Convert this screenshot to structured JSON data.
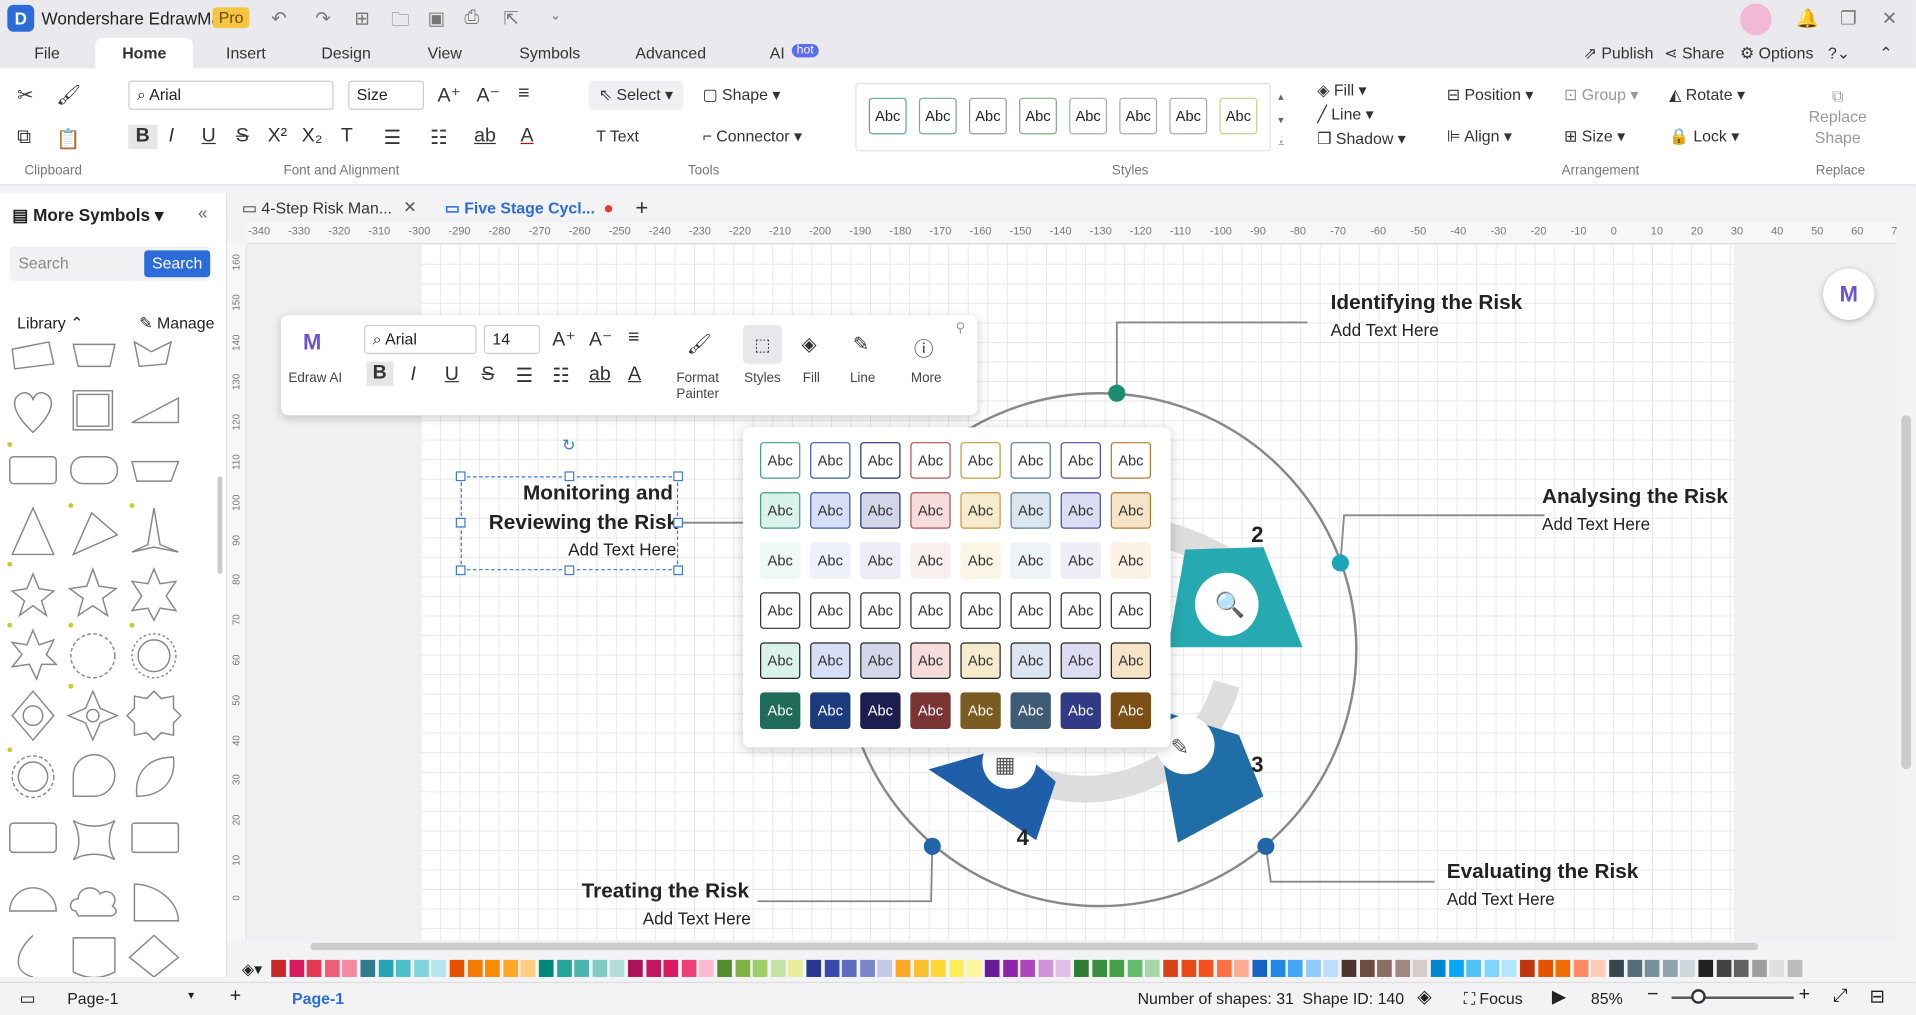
{
  "app": {
    "title": "Wondershare EdrawMax",
    "badge": "Pro"
  },
  "menu_tabs": [
    "File",
    "Home",
    "Insert",
    "Design",
    "View",
    "Symbols",
    "Advanced",
    "AI"
  ],
  "hot_badge": "hot",
  "top_right": {
    "publish": "Publish",
    "share": "Share",
    "options": "Options"
  },
  "ribbon": {
    "font": "Arial",
    "size": "Size",
    "select": "Select",
    "shape": "Shape",
    "text": "Text",
    "connector": "Connector",
    "style_samples": [
      "Abc",
      "Abc",
      "Abc",
      "Abc",
      "Abc",
      "Abc",
      "Abc",
      "Abc"
    ],
    "fill": "Fill",
    "line": "Line",
    "shadow": "Shadow",
    "position": "Position",
    "group": "Group",
    "rotate": "Rotate",
    "align": "Align",
    "lock": "Lock",
    "replace_shape": "Replace Shape",
    "groups": [
      "Clipboard",
      "Font and Alignment",
      "Tools",
      "Styles",
      "Arrangement",
      "Replace"
    ]
  },
  "sidebar": {
    "title": "More Symbols",
    "search_placeholder": "Search",
    "search_button": "Search",
    "library": "Library",
    "manage": "Manage"
  },
  "doc_tabs": [
    {
      "label": "4-Step Risk Man..."
    },
    {
      "label": "Five Stage Cycl..."
    }
  ],
  "ruler_ticks": [
    "-340",
    "-330",
    "-320",
    "-310",
    "-300",
    "-290",
    "-280",
    "-270",
    "-260",
    "-250",
    "-240",
    "-230",
    "-220",
    "-210",
    "-200",
    "-190",
    "-180",
    "-170",
    "-160",
    "-150",
    "-140",
    "-130",
    "-120",
    "-110",
    "-100",
    "-90",
    "-80",
    "-70",
    "-60",
    "-50",
    "-40",
    "-30",
    "-20",
    "-10",
    "0",
    "10",
    "20",
    "30",
    "40",
    "50",
    "60",
    "7"
  ],
  "ruler_left_ticks": [
    "160",
    "150",
    "140",
    "130",
    "120",
    "110",
    "100",
    "90",
    "80",
    "70",
    "60",
    "50",
    "40",
    "30",
    "20",
    "10",
    "0"
  ],
  "floatbar": {
    "edraw_ai": "Edraw AI",
    "font": "Arial",
    "size": "14",
    "format_painter": "Format Painter",
    "styles": "Styles",
    "fill": "Fill",
    "line": "Line",
    "more": "More"
  },
  "style_panel": {
    "cell": "Abc"
  },
  "diagram": {
    "monitoring": {
      "title1": "Monitoring and",
      "title2": "Reviewing the Risk",
      "sub": "Add Text Here"
    },
    "identifying": {
      "title": "Identifying the Risk",
      "sub": "Add Text Here"
    },
    "analysing": {
      "title": "Analysing the Risk",
      "sub": "Add Text Here"
    },
    "evaluating": {
      "title": "Evaluating the Risk",
      "sub": "Add Text Here"
    },
    "treating": {
      "title": "Treating the Risk",
      "sub": "Add Text Here"
    },
    "num2": "2",
    "num3": "3",
    "num4": "4"
  },
  "status": {
    "page_select": "Page-1",
    "page_tab": "Page-1",
    "shapes": "Number of shapes: 31",
    "shape_id": "Shape ID: 140",
    "focus": "Focus",
    "zoom": "85%"
  }
}
